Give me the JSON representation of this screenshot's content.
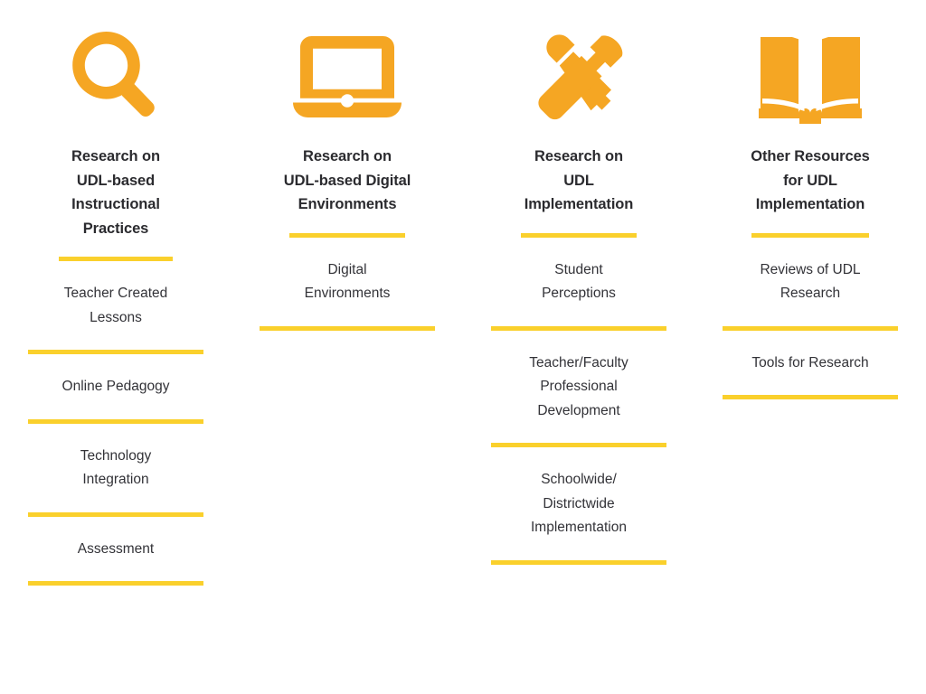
{
  "theme": {
    "background": "#ffffff",
    "icon_color": "#f5a623",
    "rule_color": "#fad02c",
    "heading_color": "#2b2b2f",
    "body_color": "#333338"
  },
  "columns": [
    {
      "id": "research-udl-based-instructional-practices",
      "icon": "magnifying-glass-icon",
      "heading": "Research on\nUDL-based\nInstructional\nPractices",
      "items": [
        {
          "label": "Teacher Created\nLessons"
        },
        {
          "label": "Online Pedagogy"
        },
        {
          "label": "Technology\nIntegration"
        },
        {
          "label": "Assessment"
        }
      ]
    },
    {
      "id": "research-udl-based-digital-environments",
      "icon": "laptop-icon",
      "heading": "Research on\nUDL-based Digital\nEnvironments",
      "items": [
        {
          "label": "Digital\nEnvironments"
        }
      ]
    },
    {
      "id": "research-udl-implementation",
      "icon": "tools-icon",
      "heading": "Research on\nUDL\nImplementation",
      "items": [
        {
          "label": "Student\nPerceptions"
        },
        {
          "label": "Teacher/Faculty\nProfessional\nDevelopment"
        },
        {
          "label": "Schoolwide/\nDistrictwide\nImplementation"
        }
      ]
    },
    {
      "id": "other-resources-for-udl-implementation",
      "icon": "open-book-icon",
      "heading": "Other Resources\nfor UDL\nImplementation",
      "items": [
        {
          "label": "Reviews of UDL\nResearch"
        },
        {
          "label": "Tools for Research"
        }
      ]
    }
  ]
}
